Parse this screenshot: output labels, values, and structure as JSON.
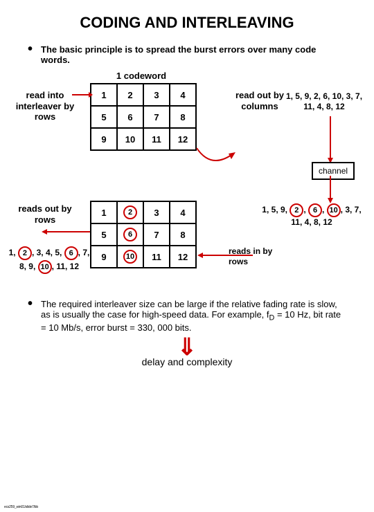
{
  "title": "CODING AND INTERLEAVING",
  "bullet1": "The basic principle is to spread the burst errors over many code words.",
  "codeword_label": "1 codeword",
  "left_label_top": "read into interleaver by rows",
  "right_label_top": "read out by columns",
  "grid_top": [
    [
      "1",
      "2",
      "3",
      "4"
    ],
    [
      "5",
      "6",
      "7",
      "8"
    ],
    [
      "9",
      "10",
      "11",
      "12"
    ]
  ],
  "seq_top": "1, 5, 9, 2, 6, 10, 3, 7, 11, 4, 8, 12",
  "channel_label": "channel",
  "left_label_bottom": "reads out by rows",
  "grid_bottom": [
    [
      "1",
      "②",
      "3",
      "4"
    ],
    [
      "5",
      "⑥",
      "7",
      "8"
    ],
    [
      "9",
      "⑩",
      "11",
      "12"
    ]
  ],
  "right_label_bottom": "reads in by rows",
  "seq_bottom_a": "1, 5, 9, ",
  "seq_bottom_b": ", 3, 7, 11, 4, 8, 12",
  "seq_bl_a": "1, ",
  "seq_bl_b": ", 3, 4, 5, ",
  "seq_bl_c": ", 7, 8, 9, ",
  "seq_bl_d": ", 11, 12",
  "bullet2_lead": "The required interleaver size can be large if the relative fading rate is slow, as is usually the case for high-speed data.  For example, f",
  "bullet2_sub": "D",
  "bullet2_rest": " = 10 Hz, bit rate = 10 Mb/s, error burst = 330, 000 bits.",
  "delay_text": "delay and complexity",
  "footer_text": "ecs259_win01/slide7/bb"
}
